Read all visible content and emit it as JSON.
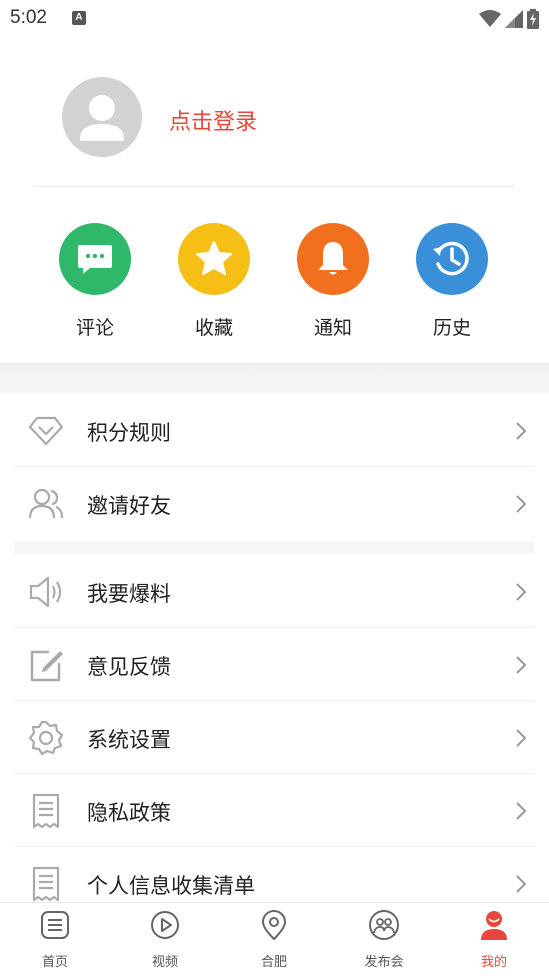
{
  "status_bar": {
    "time": "5:02",
    "notification_badge": "A",
    "icons": [
      "wifi-icon",
      "signal-icon",
      "battery-charging-icon"
    ]
  },
  "profile": {
    "login_label": "点击登录",
    "avatar_icon": "default-avatar-icon"
  },
  "quick_actions": [
    {
      "label": "评论",
      "icon": "comment-icon",
      "color": "#2fb86a"
    },
    {
      "label": "收藏",
      "icon": "star-icon",
      "color": "#f5bf16"
    },
    {
      "label": "通知",
      "icon": "bell-icon",
      "color": "#f0701e"
    },
    {
      "label": "历史",
      "icon": "history-icon",
      "color": "#3a90d8"
    }
  ],
  "menu": {
    "group1": [
      {
        "label": "积分规则",
        "icon": "diamond-icon"
      },
      {
        "label": "邀请好友",
        "icon": "friends-icon"
      }
    ],
    "group2": [
      {
        "label": "我要爆料",
        "icon": "megaphone-icon"
      },
      {
        "label": "意见反馈",
        "icon": "edit-icon"
      },
      {
        "label": "系统设置",
        "icon": "gear-icon"
      },
      {
        "label": "隐私政策",
        "icon": "document-icon"
      },
      {
        "label": "个人信息收集清单",
        "icon": "document-list-icon"
      }
    ]
  },
  "bottom_nav": {
    "active_color": "#e8463c",
    "items": [
      {
        "label": "首页",
        "icon": "home-icon"
      },
      {
        "label": "视频",
        "icon": "video-icon"
      },
      {
        "label": "合肥",
        "icon": "location-icon"
      },
      {
        "label": "发布会",
        "icon": "press-conference-icon"
      },
      {
        "label": "我的",
        "icon": "profile-icon"
      }
    ],
    "active_index": 4
  }
}
